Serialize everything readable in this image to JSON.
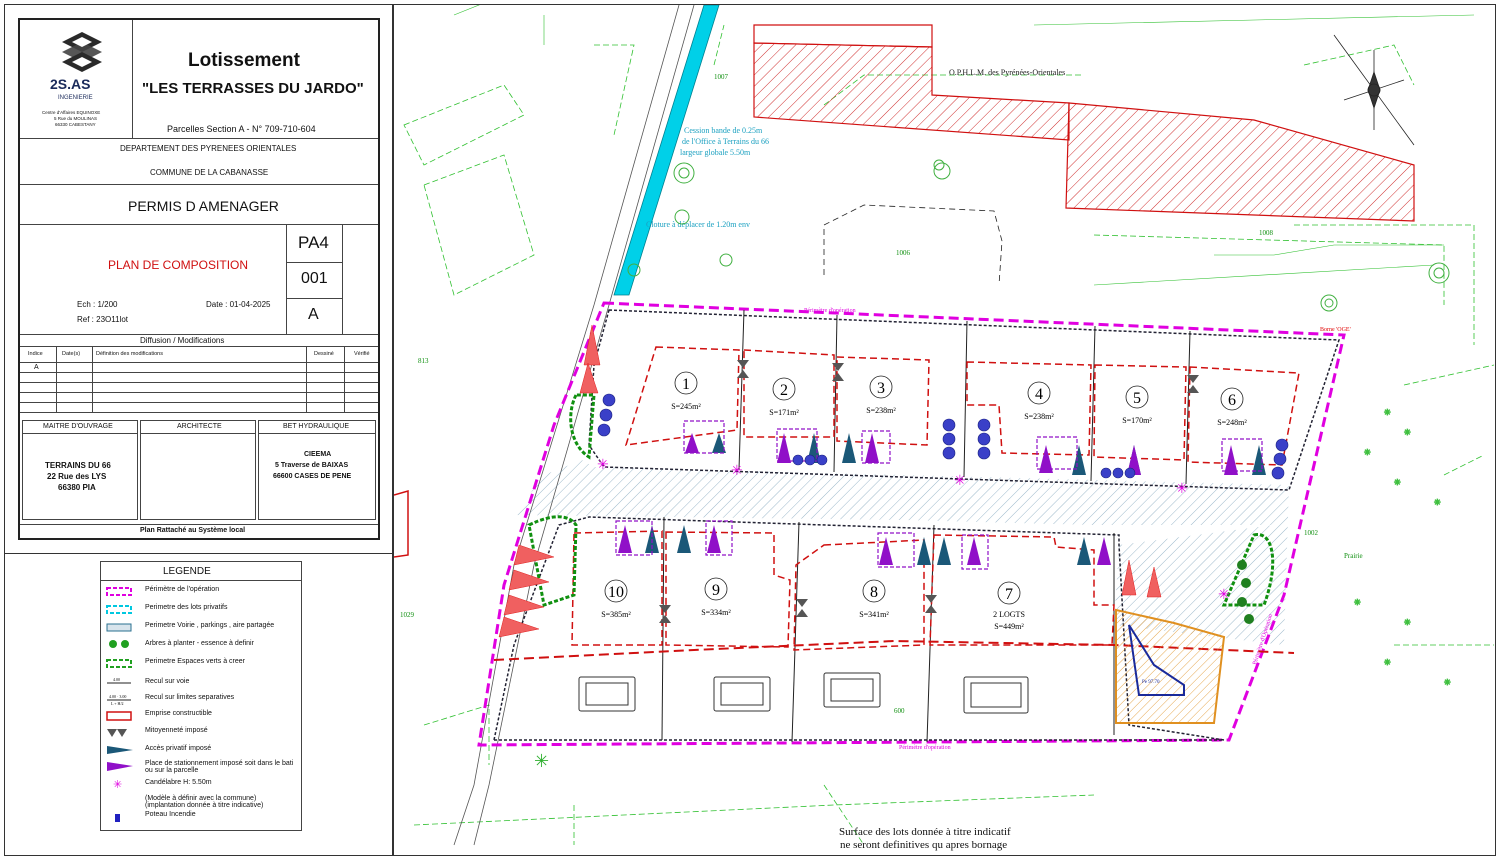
{
  "cartouche": {
    "firm_name": "2S.AS",
    "firm_sub": "INGENIERIE",
    "firm_address": [
      "Centre d'Affaires EQUINOXE",
      "5 Rue du MOULINAS",
      "66330 CABESTANY"
    ],
    "project_title": "Lotissement",
    "project_name": "\"LES TERRASSES DU JARDO\"",
    "parcels": "Parcelles Section A - N° 709-710-604",
    "department": "DEPARTEMENT DES PYRENEES ORIENTALES",
    "commune": "COMMUNE DE LA CABANASSE",
    "permit": "PERMIS D AMENAGER",
    "plan_title": "PLAN DE COMPOSITION",
    "plan_code": "PA4",
    "plan_number": "001",
    "plan_index": "A",
    "scale": "Ech : 1/200",
    "date": "Date : 01-04-2025",
    "ref": "Ref : 23O11lot",
    "diffusion_title": "Diffusion / Modifications",
    "table_headers": [
      "Indice",
      "Date(s)",
      "Définition des modifications",
      "Dessiné",
      "Vérifié"
    ],
    "table_rows": [
      [
        "A",
        "",
        "",
        "",
        ""
      ]
    ],
    "maitre_label": "MAITRE D'OUVRAGE",
    "architecte_label": "ARCHITECTE",
    "bet_label": "BET HYDRAULIQUE",
    "maitre_lines": [
      "TERRAINS DU 66",
      "22 Rue des LYS",
      "66380 PIA"
    ],
    "bet_lines": [
      "CIEEMA",
      "5 Traverse de BAIXAS",
      "66600 CASES DE PENE"
    ],
    "footer": "Plan Rattaché au Système local"
  },
  "legend": {
    "title": "LEGENDE",
    "items": [
      {
        "label": "Périmètre de l'opération",
        "color": "#e000e0"
      },
      {
        "label": "Perimetre des lots privatifs",
        "color": "#00c8e0"
      },
      {
        "label": "Perimetre Voirie , parkings , aire partagée",
        "color": "#2a7090"
      },
      {
        "label": "Arbres à planter - essence à definir",
        "color": "#20a020"
      },
      {
        "label": "Perimetre Espaces verts à creer",
        "color": "#20a020"
      },
      {
        "label": "Recul sur voie",
        "color": "#222222"
      },
      {
        "label": "Recul sur limites separatives",
        "color": "#222222"
      },
      {
        "label": "Emprise constructible",
        "color": "#d01010"
      },
      {
        "label": "Mitoyenneté imposé",
        "color": "#555555"
      },
      {
        "label": "Accès privatif imposé",
        "color": "#1b5878"
      },
      {
        "label": "Place de stationnement imposé soit dans le bati ou sur la parcelle",
        "color": "#9010c8"
      },
      {
        "label": "Candélabre H: 5.50m",
        "color": "#e000e0"
      },
      {
        "label": "(Modèle à définir avec la commune) (implantation donnée à titre indicative)",
        "color": "#222222"
      },
      {
        "label": "Poteau Incendie",
        "color": "#2020c0"
      }
    ]
  },
  "plan": {
    "lots": [
      {
        "num": "1",
        "area": "S=245m²"
      },
      {
        "num": "2",
        "area": "S=171m²"
      },
      {
        "num": "3",
        "area": "S=238m²"
      },
      {
        "num": "4",
        "area": "S=238m²"
      },
      {
        "num": "5",
        "area": "S=170m²"
      },
      {
        "num": "6",
        "area": "S=248m²"
      },
      {
        "num": "10",
        "area": "S=385m²"
      },
      {
        "num": "9",
        "area": "S=334m²"
      },
      {
        "num": "8",
        "area": "S=341m²"
      },
      {
        "num": "7",
        "area": "S=449m²",
        "extra": "2 LOGTS"
      }
    ],
    "labels": {
      "ophlm": "O.P.H.L.M. des Pyrénées-Orientales",
      "cession": [
        "Cession bande de 0.25m",
        "de l'Office à Terrains du 66",
        "largeur globale 5.50m"
      ],
      "cloture": "Cloture à déplacer de 1.20m env",
      "perimetre_top": "Périmètre d'opération",
      "perimetre_bottom": "Périmètre d'opération",
      "perimetre_right": "Périmètre d'Opération",
      "bassin": "Pe 97.70",
      "ref_1008": "1008",
      "ref_1007": "1007",
      "ref_1006": "1006",
      "ref_1002": "1002",
      "ref_600": "600",
      "ref_813": "813",
      "ref_1029": "1029",
      "prairie": "Prairie",
      "borne": "Borne 'OGE'"
    },
    "footer_note": [
      "Surface des lots donnée à titre indicatif",
      "ne seront definitives qu apres bornage"
    ]
  }
}
